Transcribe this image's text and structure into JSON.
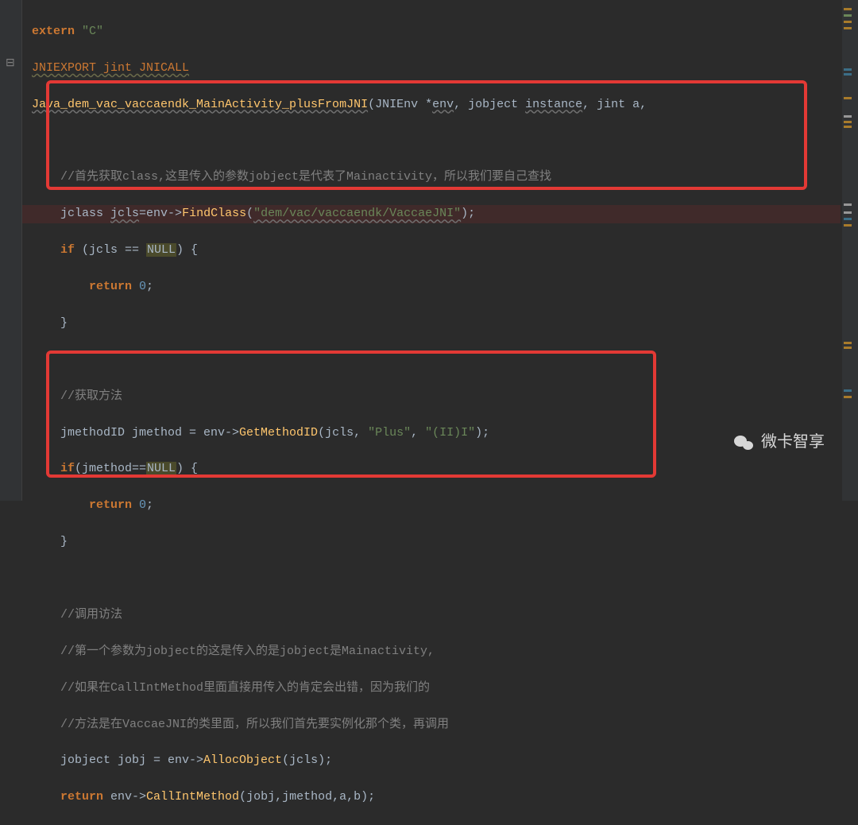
{
  "code": {
    "l01a": "extern ",
    "l01b": "\"C\"",
    "l02": "JNIEXPORT jint JNICALL",
    "l03a": "Java_dem_vac_vaccaendk_MainActivity_plusFromJNI",
    "l03b": "(JNIEnv *",
    "l03c": "env",
    "l03d": ", jobject ",
    "l03e": "instance",
    "l03f": ", jint a,",
    "l05": "    //首先获取class,这里传入的参数jobject是代表了Mainactivity，所以我们要自己查找",
    "l06a": "    jclass ",
    "l06b": "jcls",
    "l06c": "=env->",
    "l06d": "FindClass",
    "l06e": "(",
    "l06f": "\"dem/vac/vaccaendk/VaccaeJNI\"",
    "l06g": ");",
    "l07a": "    if",
    "l07b": " (jcls == ",
    "l07c": "NULL",
    "l07d": ") {",
    "l08a": "        return ",
    "l08b": "0",
    "l08c": ";",
    "l09": "    }",
    "l11": "    //获取方法",
    "l12a": "    jmethodID jmethod = env->",
    "l12b": "GetMethodID",
    "l12c": "(jcls, ",
    "l12d": "\"Plus\"",
    "l12e": ", ",
    "l12f": "\"(II)I\"",
    "l12g": ");",
    "l13a": "    if",
    "l13b": "(jmethod==",
    "l13c": "NULL",
    "l13d": ") {",
    "l14a": "        return ",
    "l14b": "0",
    "l14c": ";",
    "l15": "    }",
    "l17": "    //调用访法",
    "l18": "    //第一个参数为jobject的这是传入的是jobject是Mainactivity,",
    "l19": "    //如果在CallIntMethod里面直接用传入的肯定会出错，因为我们的",
    "l20": "    //方法是在VaccaeJNI的类里面，所以我们首先要实例化那个类，再调用",
    "l21a": "    jobject jobj = env->",
    "l21b": "AllocObject",
    "l21c": "(jcls);",
    "l22a": "    return",
    "l22b": " env->",
    "l22c": "CallIntMethod",
    "l22d": "(jobj,jmethod,a,b);"
  },
  "watermark": "微卡智享",
  "icons": {
    "gutter_collapse": "gutter-collapse-icon",
    "wechat": "wechat-icon"
  }
}
